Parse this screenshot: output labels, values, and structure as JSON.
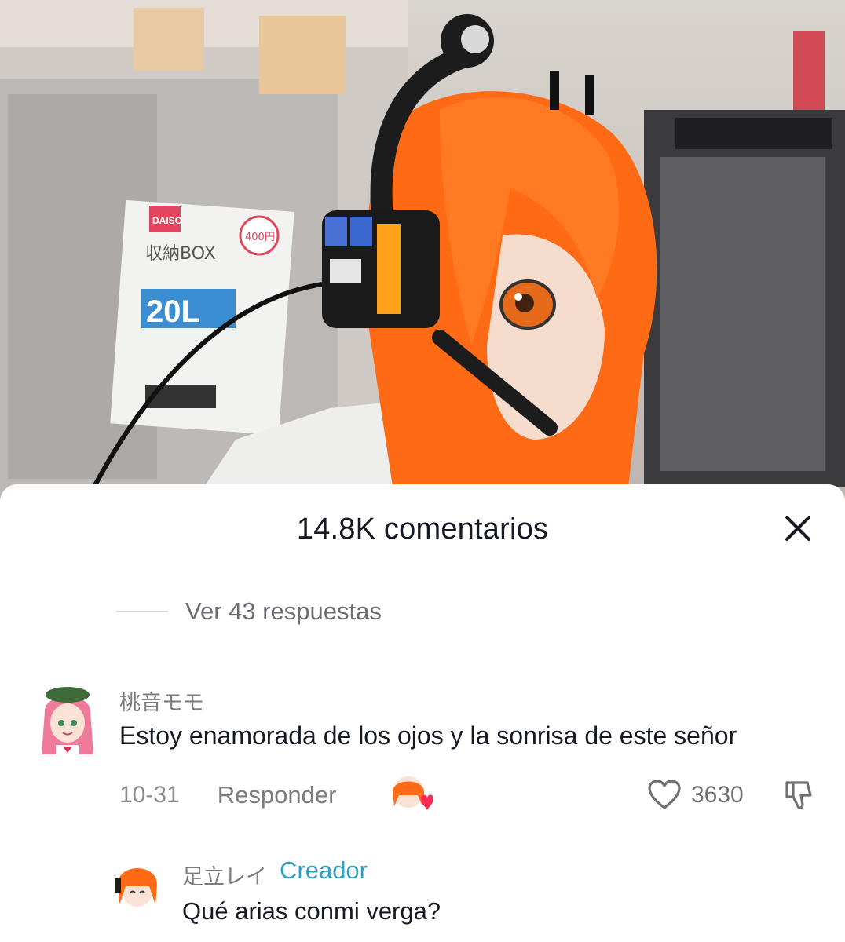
{
  "sheet": {
    "title": "14.8K comentarios",
    "close_icon": "close-icon"
  },
  "thread": {
    "view_replies_label": "Ver 43 respuestas"
  },
  "comments": [
    {
      "username": "桃音モモ",
      "text": "Estoy enamorada de los ojos y la sonrisa de este señor",
      "date": "10-31",
      "reply_label": "Responder",
      "creator_liked": true,
      "likes": "3630"
    },
    {
      "username": "足立レイ",
      "badge": "Creador",
      "text": "Qué arias conmi verga?"
    }
  ],
  "photo_labels": {
    "brand": "DAISO",
    "price": "400円",
    "product": "収納BOX",
    "size": "20L"
  },
  "colors": {
    "text_primary": "#161823",
    "text_secondary": "#7a7b80",
    "creator_badge": "#2f9fc4",
    "hair": "#ff6a14"
  }
}
